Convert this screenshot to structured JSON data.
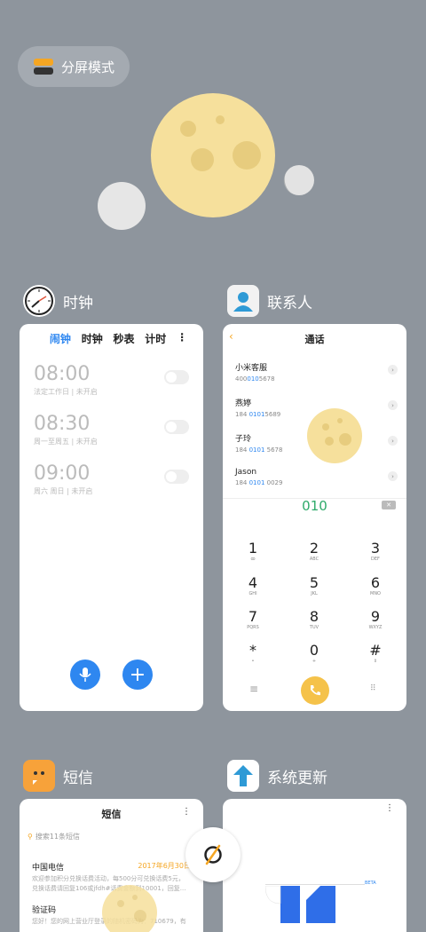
{
  "split_mode": {
    "label": "分屏模式"
  },
  "apps": [
    {
      "name": "时钟"
    },
    {
      "name": "联系人"
    },
    {
      "name": "短信"
    },
    {
      "name": "系统更新"
    }
  ],
  "clock": {
    "tabs": [
      "闹钟",
      "时钟",
      "秒表",
      "计时"
    ],
    "alarms": [
      {
        "time": "08:00",
        "sub": "法定工作日 | 未开启"
      },
      {
        "time": "08:30",
        "sub": "周一至周五 | 未开启"
      },
      {
        "time": "09:00",
        "sub": "周六 周日 | 未开启"
      }
    ]
  },
  "contacts": {
    "title": "通话",
    "list": [
      {
        "name": "小米客服",
        "pre": "400",
        "hl": "010",
        "post": "5678"
      },
      {
        "name": "燕婷",
        "pre": "184 ",
        "hl": "0101",
        "post": "5689"
      },
      {
        "name": "子玲",
        "pre": "184 ",
        "hl": "0101",
        "post": " 5678"
      },
      {
        "name": "Jason",
        "pre": "184 ",
        "hl": "0101",
        "post": " 0029"
      }
    ],
    "dial": "010",
    "keys": [
      {
        "d": "1",
        "l": "ꝏ"
      },
      {
        "d": "2",
        "l": "ABC"
      },
      {
        "d": "3",
        "l": "DEF"
      },
      {
        "d": "4",
        "l": "GHI"
      },
      {
        "d": "5",
        "l": "JKL"
      },
      {
        "d": "6",
        "l": "MNO"
      },
      {
        "d": "7",
        "l": "PQRS"
      },
      {
        "d": "8",
        "l": "TUV"
      },
      {
        "d": "9",
        "l": "WXYZ"
      },
      {
        "d": "*",
        "l": "•"
      },
      {
        "d": "0",
        "l": "+"
      },
      {
        "d": "#",
        "l": "⇕"
      }
    ]
  },
  "sms": {
    "title": "短信",
    "search": "搜索11条短信",
    "messages": [
      {
        "sender": "中国电信",
        "date": "2017年6月30日",
        "body1": "欢迎参加积分兑换话费活动，每500分可兑换话费5元，",
        "body2": "兑换话费请回复106或jfdh#话费金额到10001，回复..."
      },
      {
        "sender": "验证码",
        "date": "",
        "body1": "您好！您的网上营业厅登录的随机密码为：710679，有",
        "body2": ""
      }
    ]
  },
  "update": {
    "badge": "BETA"
  },
  "colors": {
    "background": "#8e959d",
    "accent": "#2e87f0",
    "dial_green": "#2eaa6a",
    "call_yellow": "#f5c24a",
    "sms_orange": "#f7a23a"
  }
}
